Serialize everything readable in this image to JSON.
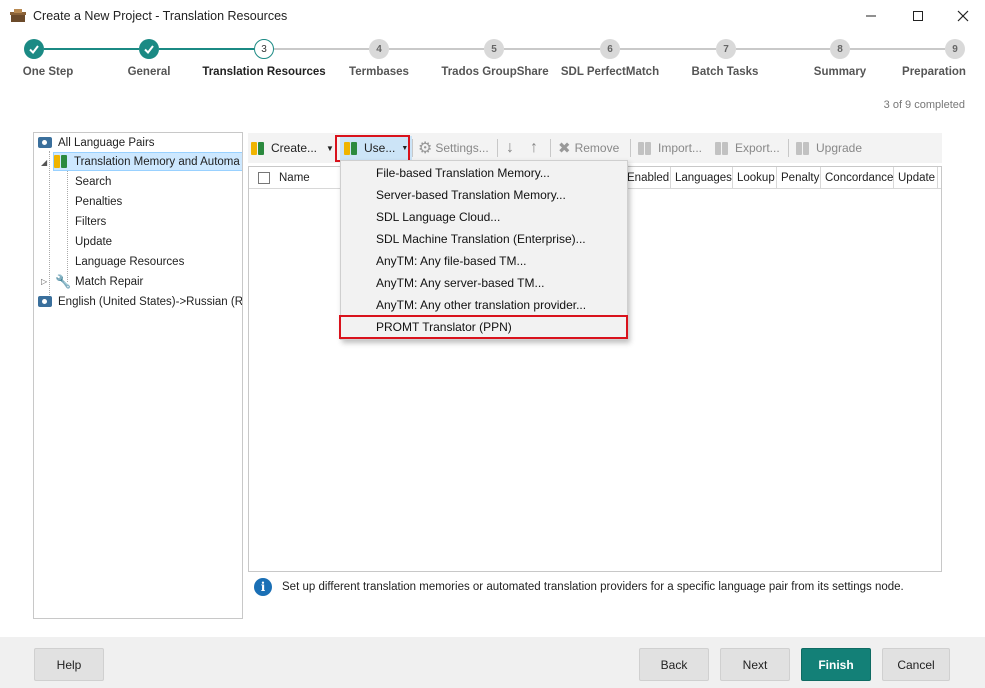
{
  "window": {
    "title": "Create a New Project - Translation Resources"
  },
  "wizard": {
    "progress_text": "3 of 9 completed",
    "steps": [
      {
        "number": "1",
        "label": "One Step",
        "state": "done"
      },
      {
        "number": "2",
        "label": "General",
        "state": "done"
      },
      {
        "number": "3",
        "label": "Translation Resources",
        "state": "current"
      },
      {
        "number": "4",
        "label": "Termbases",
        "state": "todo"
      },
      {
        "number": "5",
        "label": "Trados GroupShare",
        "state": "todo"
      },
      {
        "number": "6",
        "label": "SDL PerfectMatch",
        "state": "todo"
      },
      {
        "number": "7",
        "label": "Batch Tasks",
        "state": "todo"
      },
      {
        "number": "8",
        "label": "Summary",
        "state": "todo"
      },
      {
        "number": "9",
        "label": "Preparation",
        "state": "todo"
      }
    ]
  },
  "tree": {
    "items": [
      {
        "label": "All Language Pairs",
        "icon": "language-pair-icon"
      },
      {
        "label": "Translation Memory and Automa",
        "icon": "translation-memory-icon",
        "selected": true
      },
      {
        "label": "Search"
      },
      {
        "label": "Penalties"
      },
      {
        "label": "Filters"
      },
      {
        "label": "Update"
      },
      {
        "label": "Language Resources"
      },
      {
        "label": "Match Repair",
        "icon": "wrench-icon"
      },
      {
        "label": "English (United States)->Russian (Ru",
        "icon": "language-pair-icon"
      }
    ]
  },
  "toolbar": {
    "create_label": "Create...",
    "use_label": "Use...",
    "settings_label": "Settings...",
    "remove_label": "Remove",
    "import_label": "Import...",
    "export_label": "Export...",
    "upgrade_label": "Upgrade"
  },
  "grid": {
    "columns": [
      "Name",
      "Enabled",
      "Languages",
      "Lookup",
      "Penalty",
      "Concordance",
      "Update"
    ]
  },
  "dropdown": {
    "items": [
      "File-based Translation Memory...",
      "Server-based Translation Memory...",
      "SDL Language Cloud...",
      "SDL Machine Translation (Enterprise)...",
      "AnyTM: Any file-based TM...",
      "AnyTM: Any server-based TM...",
      "AnyTM: Any other translation provider...",
      "PROMT Translator (PPN)"
    ]
  },
  "info_text": "Set up different translation memories or automated translation providers for a specific language pair from its settings node.",
  "footer": {
    "help_label": "Help",
    "back_label": "Back",
    "next_label": "Next",
    "finish_label": "Finish",
    "cancel_label": "Cancel"
  },
  "colors": {
    "accent": "#1b8a84",
    "finish": "#138077",
    "highlight": "#d9121c",
    "selection": "#cde8ff"
  }
}
